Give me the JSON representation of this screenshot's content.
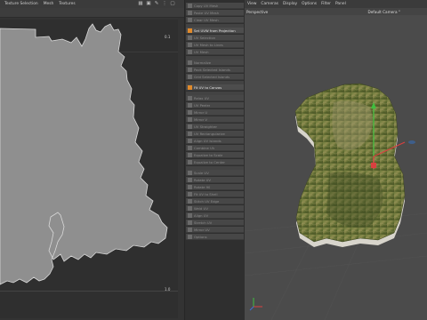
{
  "uv_editor": {
    "menus": [
      "Texture Selection",
      "Mesh",
      "Textures"
    ],
    "toolbar_icons": [
      "grid-icon",
      "lock-icon",
      "wrench-icon",
      "dots-icon",
      "expand-icon"
    ],
    "tick_top": "0.1",
    "tick_bottom": "1.0"
  },
  "palette": {
    "items": [
      {
        "label": "Copy UV Mesh",
        "active": false
      },
      {
        "label": "Paste UV Mesh",
        "active": false
      },
      {
        "label": "Clear UV Mesh",
        "active": false
      },
      {
        "label": "",
        "active": false
      },
      {
        "label": "Set UVW from Projection",
        "active": true
      },
      {
        "label": "UV Selection",
        "active": false
      },
      {
        "label": "UV Mesh to Lines",
        "active": false
      },
      {
        "label": "UV Mesh",
        "active": false
      },
      {
        "label": "",
        "active": false
      },
      {
        "label": "Normalize",
        "active": false
      },
      {
        "label": "Pack Selected Islands",
        "active": false
      },
      {
        "label": "Grid Selected Islands",
        "active": false
      },
      {
        "label": "",
        "active": false
      },
      {
        "label": "Fit UV to Canvas",
        "active": true
      },
      {
        "label": "",
        "active": false
      },
      {
        "label": "Relax UV",
        "active": false
      },
      {
        "label": "UV Peeler",
        "active": false
      },
      {
        "label": "Mirror U",
        "active": false
      },
      {
        "label": "Mirror V",
        "active": false
      },
      {
        "label": "UV Straighten",
        "active": false
      },
      {
        "label": "UV Rectangularize",
        "active": false
      },
      {
        "label": "Align UV Islands",
        "active": false
      },
      {
        "label": "Combine UV",
        "active": false
      },
      {
        "label": "Equalize to Scale",
        "active": false
      },
      {
        "label": "Equalize to Center",
        "active": false
      },
      {
        "label": "",
        "active": false
      },
      {
        "label": "Scale UV",
        "active": false
      },
      {
        "label": "Rotate UV",
        "active": false
      },
      {
        "label": "Rotate 90",
        "active": false
      },
      {
        "label": "Fit UV to Shell",
        "active": false
      },
      {
        "label": "Stitch UV Edge",
        "active": false
      },
      {
        "label": "Weld UV",
        "active": false
      },
      {
        "label": "Align UV",
        "active": false
      },
      {
        "label": "Stretch UV",
        "active": false
      },
      {
        "label": "Mirror UV",
        "active": false
      },
      {
        "label": "Options",
        "active": false
      }
    ]
  },
  "viewport": {
    "menus": [
      "View",
      "Cameras",
      "Display",
      "Options",
      "Filter",
      "Panel"
    ],
    "projection_label": "Perspective",
    "camera_label": "Default Camera",
    "camera_mark": "°"
  },
  "colors": {
    "active_icon": "#e08a2b",
    "uv_fill": "#8f8f8f",
    "axis_x": "#d94040",
    "axis_y": "#3fbf3f",
    "axis_z": "#3f6fd9"
  }
}
